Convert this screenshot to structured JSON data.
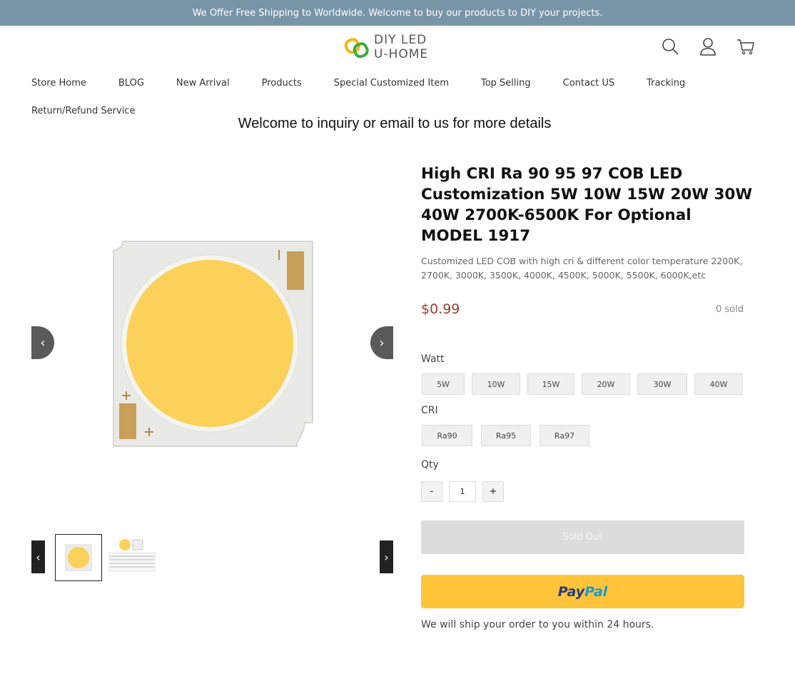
{
  "topbar": {
    "text": "We Offer Free Shipping to Worldwide. Welcome to buy our products to DIY your projects."
  },
  "logo": {
    "line1": "DIY LED",
    "line2": "U-HOME"
  },
  "header_icons": [
    "search-icon",
    "user-icon",
    "cart-icon"
  ],
  "nav": {
    "items": [
      "Store Home",
      "BLOG",
      "New Arrival",
      "Products",
      "Special Customized Item",
      "Top Selling",
      "Contact US",
      "Tracking",
      "Return/Refund Service"
    ]
  },
  "announcement": "Welcome to inquiry or email to us for more details",
  "gallery": {
    "prev_icon": "chevron-left-icon",
    "next_icon": "chevron-right-icon"
  },
  "product": {
    "title": "High CRI Ra 90 95 97 COB LED Customization 5W 10W 15W 20W 30W 40W 2700K-6500K For Optional MODEL 1917",
    "description": "Customized LED COB with high cri & different color temperature 2200K, 2700K, 3000K, 3500K, 4000K, 4500K, 5000K, 5500K, 6000K,etc",
    "price": "$0.99",
    "sold": "0 sold",
    "watt_label": "Watt",
    "watt_options": [
      "5W",
      "10W",
      "15W",
      "20W",
      "30W",
      "40W"
    ],
    "cri_label": "CRI",
    "cri_options": [
      "Ra90",
      "Ra95",
      "Ra97"
    ],
    "qty_label": "Qty",
    "qty_minus": "-",
    "qty_value": "1",
    "qty_plus": "+",
    "soldout_label": "Sold Out",
    "paypal_part1": "Pay",
    "paypal_part2": "Pal",
    "ship_note": "We will ship your order to you within 24 hours."
  },
  "colors": {
    "topbar": "#7895a7",
    "price": "#9b3a35",
    "paypal": "#ffc439",
    "led_yellow": "#fcd15a"
  }
}
